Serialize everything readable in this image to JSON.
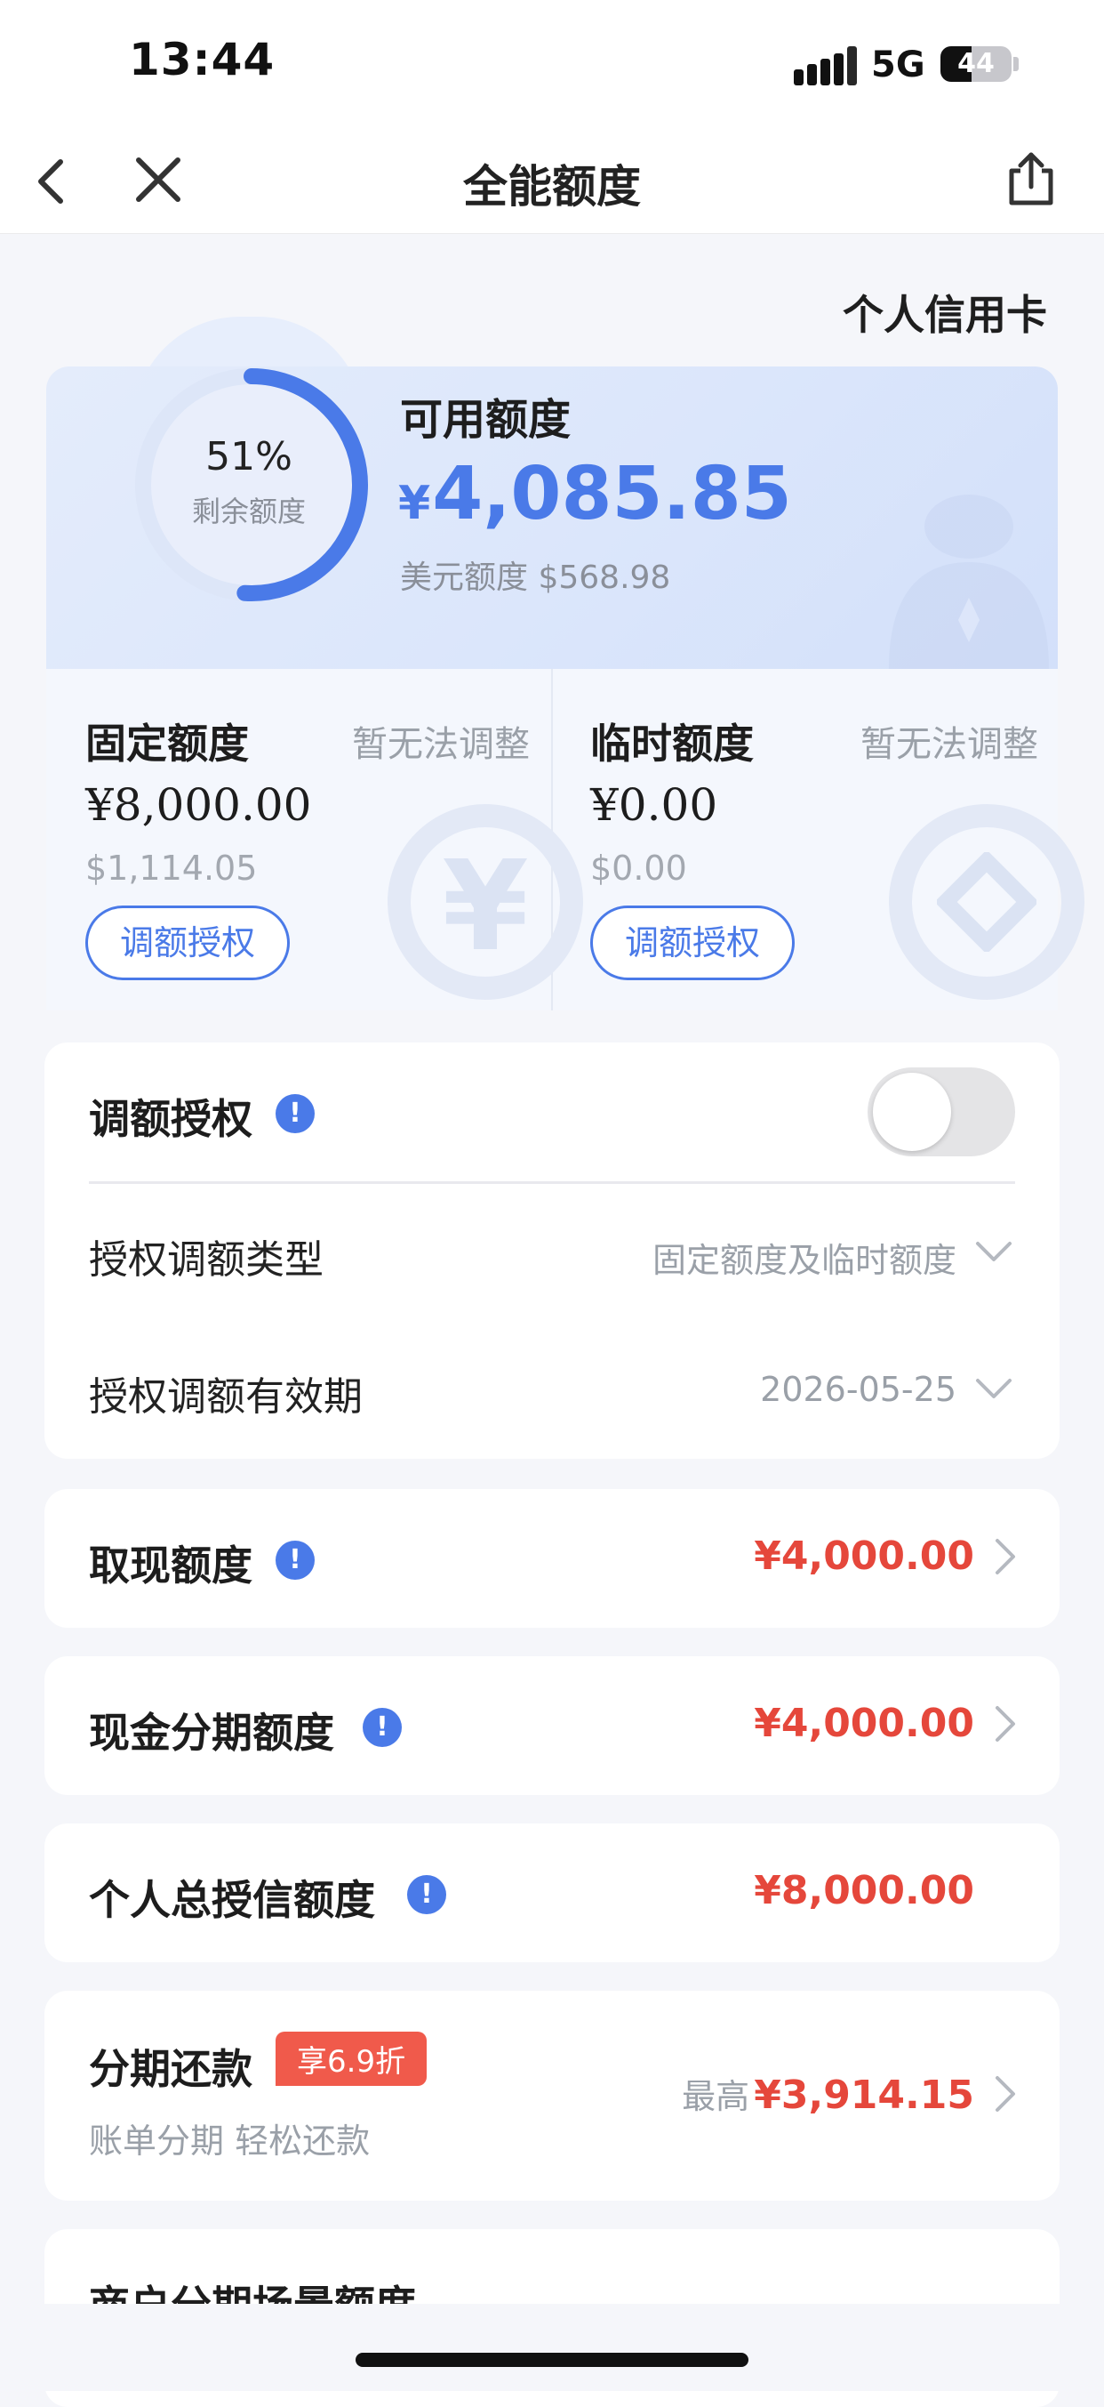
{
  "status": {
    "time": "13:44",
    "network": "5G",
    "battery": "44",
    "battery_level": 0.44
  },
  "nav": {
    "title": "全能额度",
    "back_icon": "chevron-left-icon",
    "close_icon": "close-icon",
    "share_icon": "share-icon"
  },
  "card_type": "个人信用卡",
  "summary": {
    "remaining_percent": "51%",
    "remaining_fraction": 0.51,
    "remaining_label": "剩余额度",
    "available_title": "可用额度",
    "available_currency": "¥",
    "available_amount": "4,085.85",
    "usd_label": "美元额度",
    "usd_amount": "$568.98",
    "accent_color": "#4a7ae8"
  },
  "fixed": {
    "title": "固定额度",
    "note": "暂无法调整",
    "amount": "¥8,000.00",
    "usd": "$1,114.05",
    "button": "调额授权"
  },
  "temp": {
    "title": "临时额度",
    "note": "暂无法调整",
    "amount": "¥0.00",
    "usd": "$0.00",
    "button": "调额授权"
  },
  "auth": {
    "title": "调额授权",
    "info_icon": "!",
    "toggle_on": false,
    "type_label": "授权调额类型",
    "type_value": "固定额度及临时额度",
    "period_label": "授权调额有效期",
    "period_value": "2026-05-25"
  },
  "cash": {
    "title": "取现额度",
    "info_icon": "!",
    "value": "¥4,000.00"
  },
  "cash_installment": {
    "title": "现金分期额度",
    "info_icon": "!",
    "value": "¥4,000.00"
  },
  "total_credit": {
    "title": "个人总授信额度",
    "info_icon": "!",
    "value": "¥8,000.00"
  },
  "installment": {
    "title": "分期还款",
    "badge": "享6.9折",
    "subtitle": "账单分期 轻松还款",
    "prefix": "最高",
    "value": "¥3,914.15"
  },
  "merchant": {
    "title": "商户分期场景额度"
  },
  "colors": {
    "red": "#e5473b",
    "blue": "#4a7ae8"
  }
}
